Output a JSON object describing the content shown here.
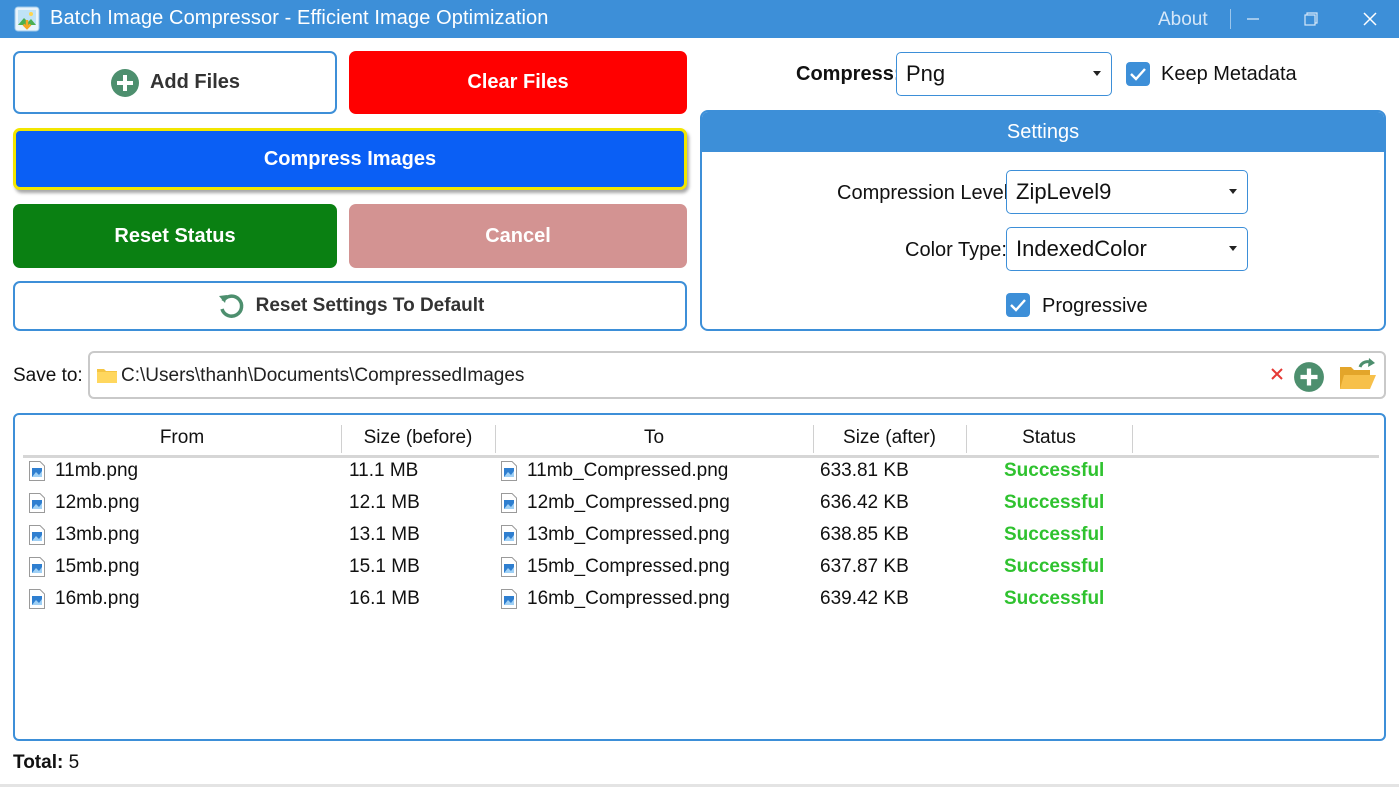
{
  "window": {
    "title": "Batch Image Compressor - Efficient Image Optimization",
    "about_label": "About"
  },
  "buttons": {
    "add_files": "Add Files",
    "clear_files": "Clear Files",
    "compress_images": "Compress Images",
    "reset_status": "Reset Status",
    "cancel": "Cancel",
    "reset_settings": "Reset Settings To Default"
  },
  "compress": {
    "label": "Compress:",
    "format_value": "Png",
    "keep_metadata_label": "Keep Metadata",
    "keep_metadata_checked": true
  },
  "settings": {
    "title": "Settings",
    "compression_level_label": "Compression Level:",
    "compression_level_value": "ZipLevel9",
    "color_type_label": "Color Type:",
    "color_type_value": "IndexedColor",
    "progressive_label": "Progressive",
    "progressive_checked": true
  },
  "save_to": {
    "label": "Save to:",
    "path": "C:\\Users\\thanh\\Documents\\CompressedImages"
  },
  "table": {
    "headers": {
      "from": "From",
      "size_before": "Size (before)",
      "to": "To",
      "size_after": "Size (after)",
      "status": "Status"
    },
    "rows": [
      {
        "from": "11mb.png",
        "size_before": "11.1 MB",
        "to": "11mb_Compressed.png",
        "size_after": "633.81 KB",
        "status": "Successful"
      },
      {
        "from": "12mb.png",
        "size_before": "12.1 MB",
        "to": "12mb_Compressed.png",
        "size_after": "636.42 KB",
        "status": "Successful"
      },
      {
        "from": "13mb.png",
        "size_before": "13.1 MB",
        "to": "13mb_Compressed.png",
        "size_after": "638.85 KB",
        "status": "Successful"
      },
      {
        "from": "15mb.png",
        "size_before": "15.1 MB",
        "to": "15mb_Compressed.png",
        "size_after": "637.87 KB",
        "status": "Successful"
      },
      {
        "from": "16mb.png",
        "size_before": "16.1 MB",
        "to": "16mb_Compressed.png",
        "size_after": "639.42 KB",
        "status": "Successful"
      }
    ]
  },
  "footer": {
    "total_label": "Total:",
    "total_value": "5"
  },
  "colors": {
    "accent": "#3d8fd8",
    "clear": "#ff0000",
    "compress": "#0a5ff5",
    "compress_border": "#f2e600",
    "reset_status": "#0a8012",
    "cancel_disabled": "#d39392",
    "status_success": "#2fc22f"
  },
  "icons": {
    "app": "image-download-icon",
    "add_files": "plus-circle-icon",
    "reset_settings": "refresh-icon",
    "folder": "folder-icon",
    "clear_path": "close-icon",
    "add_path": "plus-circle-icon",
    "browse": "open-folder-icon",
    "file": "image-file-icon"
  }
}
